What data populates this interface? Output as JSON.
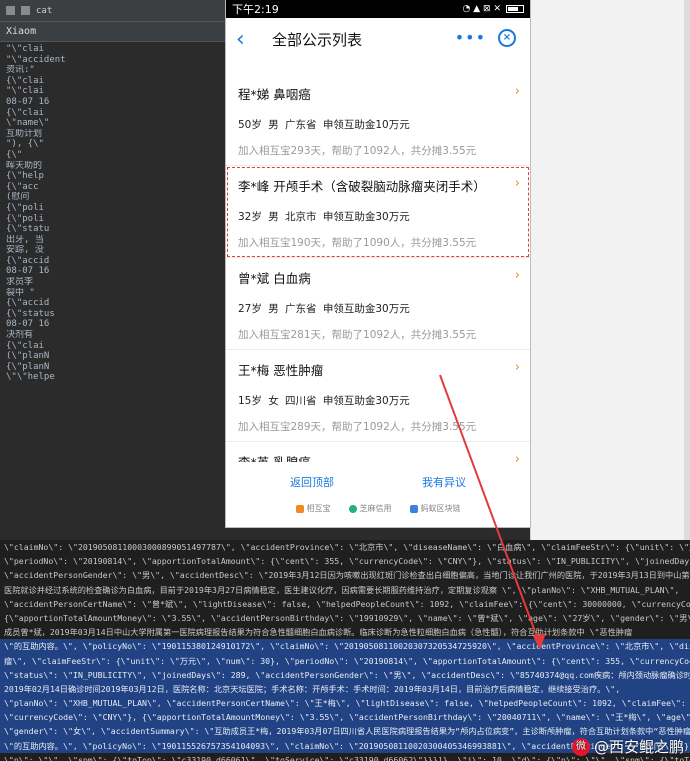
{
  "ide": {
    "tab_label": "Xiaom",
    "small_label": "cat",
    "left_lines": [
      "\"\\\"clai",
      "\"\\\"accident",
      "资讯:\"",
      "{\\\"clai",
      "\"\\\"clai",
      "08-07 16",
      "{\\\"clai",
      "\\\"name\\\"",
      "互助计划",
      "\"), {\\\"",
      "{\\\"",
      "晖天助的",
      "{\\\"help",
      "{\\\"acc",
      "(慰问",
      "{\\\"poli",
      "{\\\"poli",
      "{\\\"statu",
      "出牙, 当",
      "安踪, 没",
      "{\\\"accid",
      "08-07 16",
      "求员李",
      "裂中 \"",
      "{\\\"accid",
      "{\\\"status",
      "08-07 16",
      "决剂有",
      "{\\\"clai",
      "(\\\"planN",
      "{\\\"planN",
      "\\\"\\\"helpe"
    ]
  },
  "log": {
    "lines": [
      "\\\"claimNo\\\": \\\"20190508110003000899051497787\\\", \\\"accidentProvince\\\": \\\"北京市\\\", \\\"diseaseName\\\": \\\"白血病\\\", \\\"claimFeeStr\\\": {\\\"unit\\\": \\\"万元\\\", \\\"num\\\": 30},",
      "\\\"periodNo\\\": \\\"20190814\\\", \\\"apportionTotalAmount\\\": {\\\"cent\\\": 355, \\\"currencyCode\\\": \\\"CNY\\\"}, \\\"status\\\": \\\"IN_PUBLICITY\\\", \\\"joinedDays\\\": 281,",
      "\\\"accidentPersonGender\\\": \\\"男\\\", \\\"accidentDesc\\\": \\\"2019年3月12日因为咳嗽出现红斑门诊检查出白细胞偏高，当地门诊让我们广州的医院，于2019年3月13日到中山第一附属",
      "医院就诊并经过系统的检查确诊为白血病，目前于2019年3月27日病情稳定，医生建议化疗，因病需要长期服药维持治疗，定期复诊观察 \\\", \\\"planNo\\\": \\\"XHB_MUTUAL_PLAN\\\",",
      "\\\"accidentPersonCertName\\\": \\\"曾*斌\\\", \\\"lightDisease\\\": false, \\\"helpedPeopleCount\\\": 1092, \\\"claimFee\\\": {\\\"cent\\\": 30000000, \\\"currencyCode\\\": \\\"CNY\\\"}},",
      "{\\\"apportionTotalAmountMoney\\\": \\\"3.55\\\", \\\"accidentPersonBirthday\\\": \\\"19910929\\\", \\\"name\\\": \\\"曾*斌\\\", \\\"age\\\": \\\"27岁\\\", \\\"gender\\\": \\\"男\\\", \\\"accidentSummary\\\": \\\"互助",
      "成员曾*斌，2019年03月14日中山大学附属第一医院病理报告结果为符合急性髓细胞白血病诊断。临床诊断为急性粒细胞白血病（急性髓），符合互助计划条款中 \\\"恶性肿瘤",
      "\\\"的互助内容。\\\", \\\"policyNo\\\": \\\"190115380124910172\\\", \\\"claimNo\\\": \\\"20190508110020307320534725920\\\", \\\"accidentProvince\\\": \\\"北京市\\\", \\\"diseaseName\\\": \\\"恶性肿",
      "瘤\\\", \\\"claimFeeStr\\\": {\\\"unit\\\": \\\"万元\\\", \\\"num\\\": 30}, \\\"periodNo\\\": \\\"20190814\\\", \\\"apportionTotalAmount\\\": {\\\"cent\\\": 355, \\\"currencyCode\\\": \\\"CNY\\\"},",
      "\\\"status\\\": \\\"IN_PUBLICITY\\\", \\\"joinedDays\\\": 289, \\\"accidentPersonGender\\\": \\\"男\\\", \\\"accidentDesc\\\": \\\"85740374@qq.com疾病：颅内颈动脉瘤确诊时间：初次确诊时间：",
      "2019年02月14日确诊时间2019年03月12日，医院名称：北京天坛医院；手术名称：开颅手术：手术时间：2019年03月14日，目前治疗后病情稳定，继续接受治疗。\\\",",
      "\\\"planNo\\\": \\\"XHB_MUTUAL_PLAN\\\", \\\"accidentPersonCertName\\\": \\\"王*梅\\\", \\\"lightDisease\\\": false, \\\"helpedPeopleCount\\\": 1092, \\\"claimFee\\\": {\\\"cent\\\": 30000000,",
      "\\\"currencyCode\\\": \\\"CNY\\\"}, {\\\"apportionTotalAmountMoney\\\": \\\"3.55\\\", \\\"accidentPersonBirthday\\\": \\\"20040711\\\", \\\"name\\\": \\\"王*梅\\\", \\\"age\\\": \\\"15岁\\\",",
      "\\\"gender\\\": \\\"女\\\", \\\"accidentSummary\\\": \\\"互助成员王*梅，2019年03月07日四川省人民医院病理报告结果为“颅内占位病变”，主诊断颅肿瘤，符合互助计划条款中“恶性肿瘤",
      "\\\"的互助内容。\\\", \\\"policyNo\\\": \\\"190115526757354104093\\\", \\\"claimNo\\\": \\\"20190508110020300405346993881\\\", \\\"accidentProvince\\\": \\\"四川省\\\"}]}}, \\\"i\\\": 9}",
      "\\\"n\\\": \\\"\\\", \\\"spm\\\": {\\\"toTop\\\": \\\"c33190.d66061\\\", \\\"toService\\\": \\\"c33190.d66062\\\"}}}]}, \\\"i\\\": 10, \\\"d\\\": {\\\"n\\\": \\\"\\\", \\\"spm\\\": {\\\"toTop\\\": \\\"c33190.d66061\\\",",
      "\\\"toService\\\": \\\"c33190.d66062\\\"}}}]}}\\\""
    ]
  },
  "phone": {
    "status_time": "下午2:19",
    "status_icons": "◔ ▲ ⊠ ✕",
    "back_glyph": "‹",
    "title": "全部公示列表",
    "more_glyph": "•••",
    "close_glyph": "×"
  },
  "items": [
    {
      "title": "程*娣   鼻咽癌",
      "info": "50岁   男   广东省   申领互助金10万元",
      "meta": "加入相互宝293天，帮助了1092人，共分摊3.55元",
      "arrow": "›"
    },
    {
      "title": "李*峰   开颅手术（含破裂脑动脉瘤夹闭手术）",
      "info": "32岁   男   北京市   申领互助金30万元",
      "meta": "加入相互宝190天，帮助了1090人，共分摊3.55元",
      "arrow": "›"
    },
    {
      "title": "曾*斌   白血病",
      "info": "27岁   男   广东省   申领互助金30万元",
      "meta": "加入相互宝281天，帮助了1092人，共分摊3.55元",
      "arrow": "›"
    },
    {
      "title": "王*梅   恶性肿瘤",
      "info": "15岁   女   四川省   申领互助金30万元",
      "meta": "加入相互宝289天，帮助了1092人，共分摊3.55元",
      "arrow": "›"
    },
    {
      "title": "李*英   乳腺癌",
      "info": "",
      "meta": "",
      "arrow": "›"
    }
  ],
  "footer": {
    "back_top": "返回顶部",
    "objection": "我有异议",
    "partner1": "相互宝",
    "partner2": "芝麻信用",
    "partner3": "蚂蚁区块链"
  },
  "watermark": "@西安鲲之鹏",
  "colors": {
    "accent": "#1a78e0",
    "arrow": "#f08a24",
    "annotation": "#e23b3b",
    "highlight": "#214283"
  }
}
